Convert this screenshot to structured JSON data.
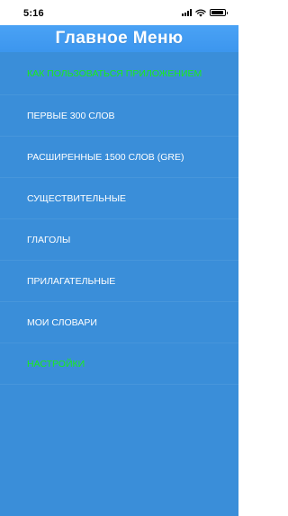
{
  "status_bar": {
    "time": "5:16",
    "icons": [
      "signal-icon",
      "wifi-icon",
      "battery-icon"
    ],
    "battery_level": 0.9
  },
  "header": {
    "title": "Главное Меню"
  },
  "colors": {
    "header": "#4aa2f5",
    "menu_background": "#3a8ed9",
    "text": "#ffffff",
    "accent_text": "#19ec1b"
  },
  "menu": {
    "items": [
      {
        "label": "КАК ПОЛЬЗОВАТЬСЯ ПРИЛОЖЕНИЕМ"
      },
      {
        "label": "ПЕРВЫЕ 300 СЛОВ"
      },
      {
        "label": "РАСШИРЕННЫЕ 1500 СЛОВ (GRE)"
      },
      {
        "label": "СУЩЕСТВИТЕЛЬНЫЕ"
      },
      {
        "label": "ГЛАГОЛЫ"
      },
      {
        "label": "ПРИЛАГАТЕЛЬНЫЕ"
      },
      {
        "label": "МОИ СЛОВАРИ"
      },
      {
        "label": "НАСТРОЙКИ"
      }
    ]
  }
}
